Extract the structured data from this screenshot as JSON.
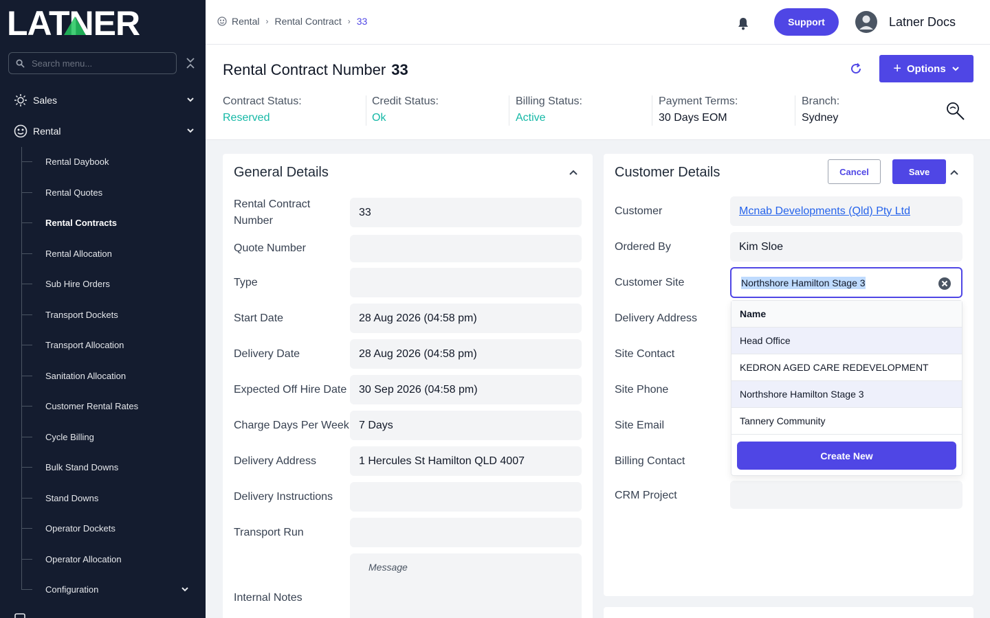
{
  "brand": {
    "logo_text": "LATNER",
    "accent": "#4f46e5",
    "sidebar_bg": "#141c2f"
  },
  "sidebar": {
    "search_placeholder": "Search menu...",
    "sections": [
      {
        "label": "Sales",
        "icon": "gear-sparkle-icon"
      },
      {
        "label": "Rental",
        "icon": "palette-icon"
      }
    ],
    "items": [
      {
        "label": "Rental Daybook"
      },
      {
        "label": "Rental Quotes"
      },
      {
        "label": "Rental Contracts",
        "active": true
      },
      {
        "label": "Rental Allocation"
      },
      {
        "label": "Sub Hire Orders"
      },
      {
        "label": "Transport Dockets"
      },
      {
        "label": "Transport Allocation"
      },
      {
        "label": "Sanitation Allocation"
      },
      {
        "label": "Customer Rental Rates"
      },
      {
        "label": "Cycle Billing"
      },
      {
        "label": "Bulk Stand Downs"
      },
      {
        "label": "Stand Downs"
      },
      {
        "label": "Operator Dockets"
      },
      {
        "label": "Operator Allocation"
      },
      {
        "label": "Configuration"
      }
    ]
  },
  "topbar": {
    "breadcrumb": [
      "Rental",
      "Rental Contract",
      "33"
    ],
    "support_label": "Support",
    "user_name": "Latner Docs"
  },
  "header": {
    "title": "Rental Contract Number",
    "number": "33",
    "options_label": "Options",
    "stats": [
      {
        "label": "Contract Status:",
        "value": "Reserved",
        "color": "#14b8a6"
      },
      {
        "label": "Credit Status:",
        "value": "Ok",
        "color": "#14b8a6"
      },
      {
        "label": "Billing Status:",
        "value": "Active",
        "color": "#14b8a6"
      },
      {
        "label": "Payment Terms:",
        "value": "30 Days EOM",
        "color": "#111827"
      },
      {
        "label": "Branch:",
        "value": "Sydney",
        "color": "#111827"
      }
    ]
  },
  "general": {
    "title": "General Details",
    "fields": [
      {
        "label": "Rental Contract Number",
        "value": "33"
      },
      {
        "label": "Quote Number",
        "value": ""
      },
      {
        "label": "Type",
        "value": ""
      },
      {
        "label": "Start Date",
        "value": "28 Aug 2026 (04:58 pm)"
      },
      {
        "label": "Delivery Date",
        "value": "28 Aug 2026 (04:58 pm)"
      },
      {
        "label": "Expected Off Hire Date",
        "value": "30 Sep 2026 (04:58 pm)"
      },
      {
        "label": "Charge Days Per Week",
        "value": "7 Days"
      },
      {
        "label": "Delivery Address",
        "value": "1 Hercules St Hamilton QLD 4007"
      },
      {
        "label": "Delivery Instructions",
        "value": ""
      },
      {
        "label": "Transport Run",
        "value": ""
      },
      {
        "label": "Internal Notes",
        "value": ""
      }
    ],
    "notes_placeholder": "Message"
  },
  "customer": {
    "title": "Customer Details",
    "cancel_label": "Cancel",
    "save_label": "Save",
    "fields": [
      {
        "label": "Customer",
        "value": "Mcnab Developments (Qld) Pty Ltd"
      },
      {
        "label": "Ordered By",
        "value": "Kim Sloe"
      },
      {
        "label": "Customer Site",
        "value": "Northshore Hamilton Stage 3"
      },
      {
        "label": "Delivery Address",
        "value": ""
      },
      {
        "label": "Site Contact",
        "value": ""
      },
      {
        "label": "Site Phone",
        "value": ""
      },
      {
        "label": "Site Email",
        "value": ""
      },
      {
        "label": "Billing Contact",
        "value": ""
      },
      {
        "label": "CRM Project",
        "value": ""
      }
    ],
    "dropdown": {
      "header": "Name",
      "options": [
        "Head Office",
        "KEDRON AGED CARE REDEVELOPMENT",
        "Northshore Hamilton Stage 3",
        "Tannery Community"
      ],
      "create_label": "Create New"
    }
  }
}
